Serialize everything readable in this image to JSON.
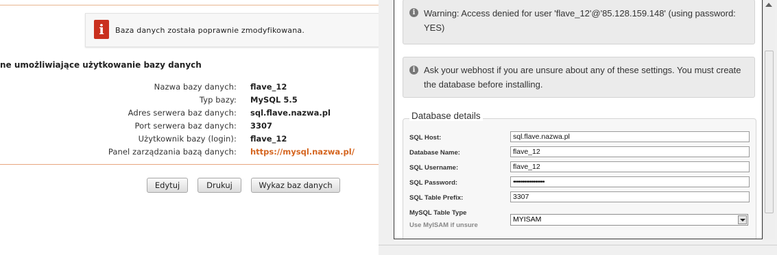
{
  "left": {
    "notice": {
      "message": "Baza danych została poprawnie zmodyfikowana.",
      "icon": "info-icon",
      "icon_color": "#c9301e"
    },
    "section_title": "ne umożliwiające użytkowanie bazy danych",
    "rows": [
      {
        "label": "Nazwa bazy danych:",
        "value": "flave_12"
      },
      {
        "label": "Typ bazy:",
        "value": "MySQL 5.5"
      },
      {
        "label": "Adres serwera baz danych:",
        "value": "sql.flave.nazwa.pl"
      },
      {
        "label": "Port serwera baz danych:",
        "value": "3307"
      },
      {
        "label": "Użytkownik bazy (login):",
        "value": "flave_12"
      },
      {
        "label": "Panel zarządzania bazą danych:",
        "value": "https://mysql.nazwa.pl/"
      }
    ],
    "buttons": {
      "edit": "Edytuj",
      "print": "Drukuj",
      "list": "Wykaz baz danych"
    },
    "accent_color": "#d5651f"
  },
  "right": {
    "warning": "Warning: Access denied for user 'flave_12'@'85.128.159.148' (using password: YES)",
    "info": "Ask your webhost if you are unsure about any of these settings. You must create the database before installing.",
    "fieldset": {
      "legend": "Database details",
      "fields": [
        {
          "label": "SQL Host:",
          "value": "sql.flave.nazwa.pl"
        },
        {
          "label": "Database Name:",
          "value": "flave_12"
        },
        {
          "label": "SQL Username:",
          "value": "flave_12"
        },
        {
          "label": "SQL Password:",
          "value": "•••••••••••••••••"
        },
        {
          "label": "SQL Table Prefix:",
          "value": "3307"
        }
      ],
      "table_type": {
        "label": "MySQL Table Type",
        "hint": "Use MyISAM if unsure",
        "selected": "MYISAM"
      }
    }
  }
}
